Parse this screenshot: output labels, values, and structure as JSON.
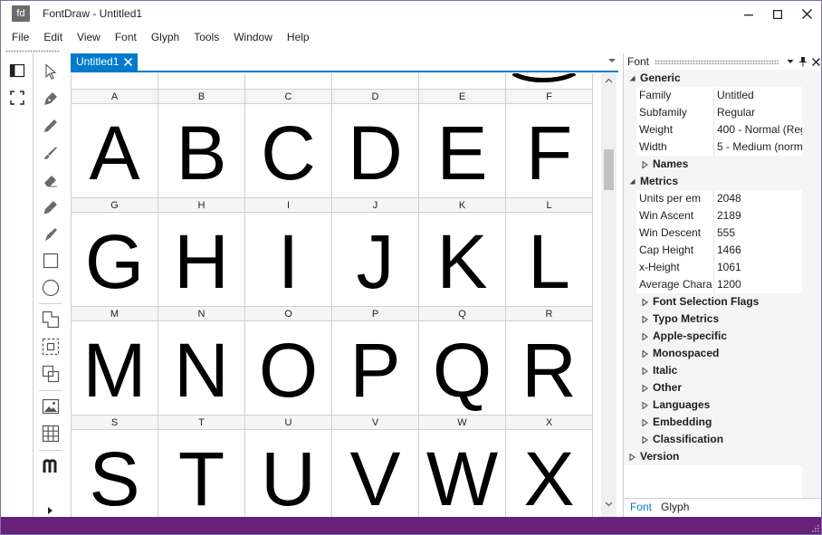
{
  "window": {
    "app_icon_text": "fd",
    "title": "FontDraw - Untitled1",
    "statusbar_color": "#68217a",
    "accent_color": "#007acc"
  },
  "menu": [
    "File",
    "Edit",
    "View",
    "Font",
    "Glyph",
    "Tools",
    "Window",
    "Help"
  ],
  "left_strip_icons": [
    "panel-toggle-icon",
    "fullscreen-icon"
  ],
  "toolbox": [
    "pointer-icon",
    "pen-icon",
    "pencil-icon",
    "brush-icon",
    "eraser-icon",
    "marker-icon",
    "knife-icon",
    "rectangle-icon",
    "ellipse-icon",
    "union-icon",
    "selection-icon",
    "intersect-icon",
    "image-icon",
    "grid-icon",
    "glyph-m-icon"
  ],
  "document": {
    "tab_label": "Untitled1"
  },
  "glyph_grid": {
    "columns": 6,
    "rows": [
      [
        "A",
        "B",
        "C",
        "D",
        "E",
        "F"
      ],
      [
        "G",
        "H",
        "I",
        "J",
        "K",
        "L"
      ],
      [
        "M",
        "N",
        "O",
        "P",
        "Q",
        "R"
      ],
      [
        "S",
        "T",
        "U",
        "V",
        "W",
        "X"
      ]
    ]
  },
  "font_panel": {
    "title": "Font",
    "categories": {
      "generic": "Generic",
      "metrics": "Metrics",
      "version": "Version"
    },
    "generic_props": [
      {
        "name": "Family",
        "value": "Untitled"
      },
      {
        "name": "Subfamily",
        "value": "Regular"
      },
      {
        "name": "Weight",
        "value": "400 - Normal (Reg"
      },
      {
        "name": "Width",
        "value": "5 - Medium (norm"
      }
    ],
    "generic_sub": [
      "Names"
    ],
    "metrics_props": [
      {
        "name": "Units per em",
        "value": "2048"
      },
      {
        "name": "Win Ascent",
        "value": "2189"
      },
      {
        "name": "Win Descent",
        "value": "555"
      },
      {
        "name": "Cap Height",
        "value": "1466"
      },
      {
        "name": "x-Height",
        "value": "1061"
      },
      {
        "name": "Average Chara",
        "value": "1200"
      }
    ],
    "metrics_sub": [
      "Font Selection Flags",
      "Typo Metrics",
      "Apple-specific",
      "Monospaced",
      "Italic",
      "Other",
      "Languages",
      "Embedding",
      "Classification"
    ],
    "tabs": [
      "Font",
      "Glyph"
    ]
  }
}
